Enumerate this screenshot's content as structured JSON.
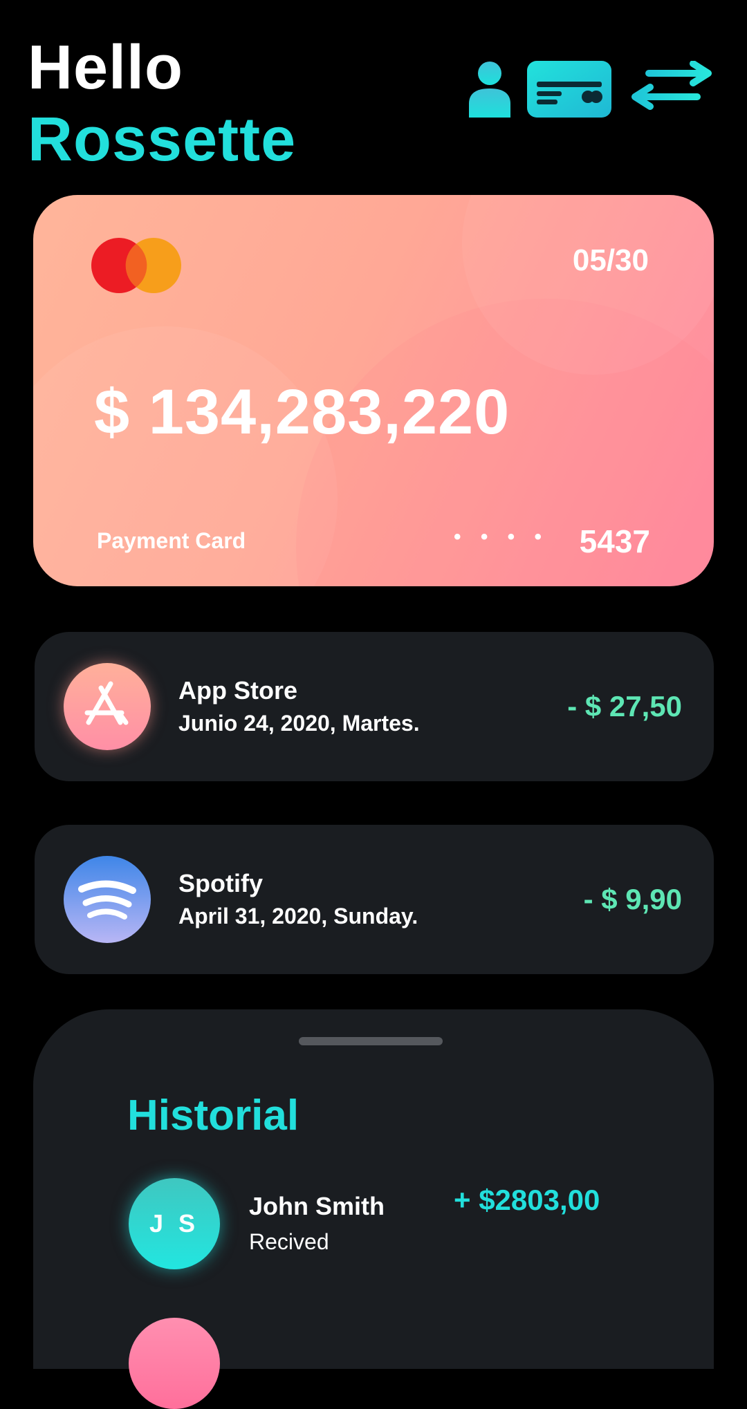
{
  "header": {
    "greeting": "Hello",
    "name": "Rossette",
    "icons": [
      "user-icon",
      "card-icon",
      "transfer-icon"
    ],
    "accent": "#22dfdc"
  },
  "card": {
    "brand_icon": "mastercard-logo",
    "expiry": "05/30",
    "balance": "$ 134,283,220",
    "label": "Payment Card",
    "masked": "• • • •",
    "last4": "5437",
    "gradient": [
      "#ffb59a",
      "#ff8aa0"
    ]
  },
  "transactions": [
    {
      "icon": "app-store-icon",
      "title": "App Store",
      "date": "Junio 24, 2020, Martes.",
      "amount": "- $ 27,50"
    },
    {
      "icon": "spotify-icon",
      "title": "Spotify",
      "date": "April 31, 2020, Sunday.",
      "amount": "- $ 9,90"
    }
  ],
  "history": {
    "title": "Historial",
    "items": [
      {
        "initials": "J S",
        "name": "John Smith",
        "status": "Recived",
        "amount": "+ $2803,00"
      }
    ]
  },
  "colors": {
    "background": "#000000",
    "panel": "#1a1d21",
    "negative_amount": "#5ee6b4",
    "positive_amount": "#22dfdc"
  }
}
